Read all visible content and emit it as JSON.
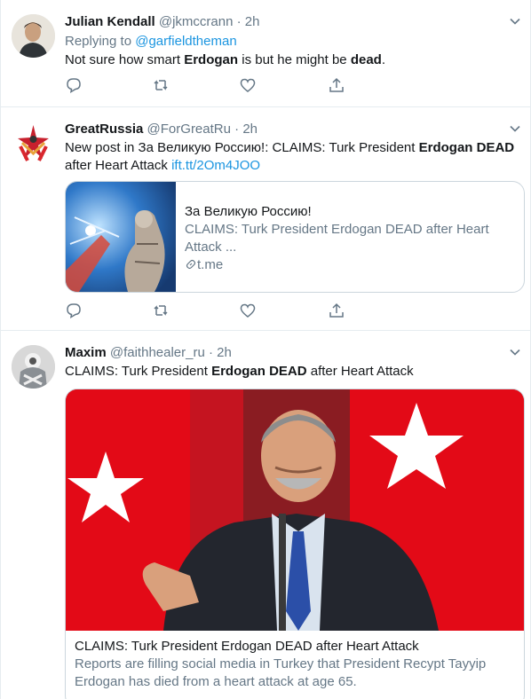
{
  "tweets": [
    {
      "name": "Julian Kendall",
      "handle": "@jkmccrann",
      "dot": "·",
      "time": "2h",
      "replying_prefix": "Replying to ",
      "replying_handle": "@garfieldtheman",
      "text_parts": [
        "Not sure how smart ",
        "Erdogan",
        " is but he might be ",
        "dead",
        "."
      ]
    },
    {
      "name": "GreatRussia",
      "handle": "@ForGreatRu",
      "dot": "·",
      "time": "2h",
      "text_parts": [
        "New post in За Великую Россию!: CLAIMS: Turk President ",
        "Erdogan DEAD",
        " after Heart Attack "
      ],
      "link": "ift.tt/2Om4JOO",
      "card": {
        "title": "За Великую Россию!",
        "desc": "CLAIMS: Turk President Erdogan DEAD after Heart Attack ...",
        "domain": "t.me"
      }
    },
    {
      "name": "Maxim",
      "handle": "@faithhealer_ru",
      "dot": "·",
      "time": "2h",
      "text_parts": [
        "CLAIMS: Turk President ",
        "Erdogan DEAD",
        " after Heart Attack"
      ],
      "card": {
        "title": "CLAIMS: Turk President Erdogan DEAD after Heart Attack",
        "desc": "Reports are filling social media in Turkey that President Recypt Tayyip Erdogan has died from a heart attack at age 65."
      }
    }
  ],
  "icons": [
    "reply-icon",
    "retweet-icon",
    "like-icon",
    "share-icon",
    "caret-down-icon"
  ],
  "colors": {
    "text": "#14171a",
    "secondary": "#657786",
    "link": "#1b95e0",
    "border": "#e6ecf0",
    "flag_red": "#e30a17"
  }
}
